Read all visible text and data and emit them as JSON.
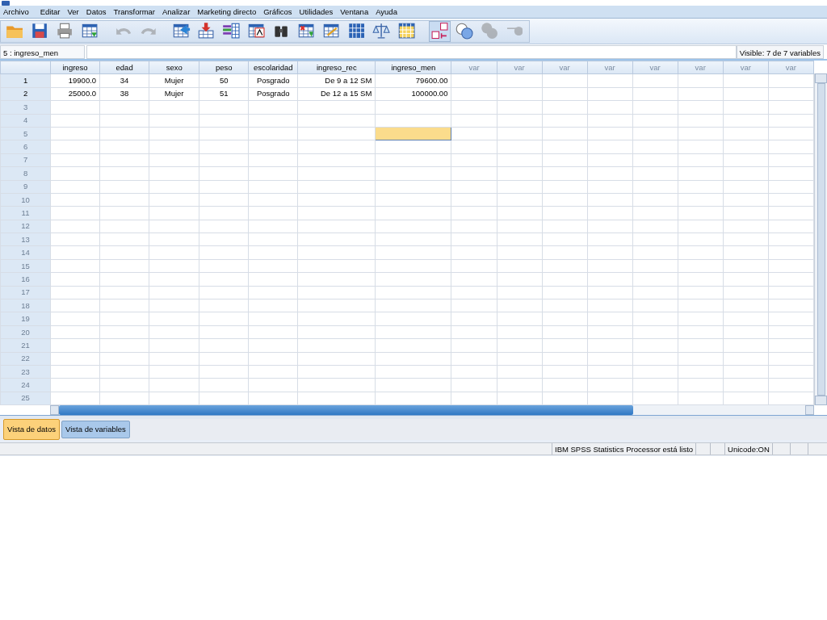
{
  "menu": [
    {
      "label": "Archivo"
    },
    {
      "label": "Editar"
    },
    {
      "label": "Ver"
    },
    {
      "label": "Datos"
    },
    {
      "label": "Transformar"
    },
    {
      "label": "Analizar"
    },
    {
      "label": "Marketing directo"
    },
    {
      "label": "Gráficos"
    },
    {
      "label": "Utilidades"
    },
    {
      "label": "Ventana"
    },
    {
      "label": "Ayuda"
    }
  ],
  "toolbar": [
    {
      "kind": "folder"
    },
    {
      "kind": "save"
    },
    {
      "kind": "print"
    },
    {
      "kind": "recall"
    },
    {
      "kind": "sep"
    },
    {
      "kind": "undo",
      "disabled": true
    },
    {
      "kind": "redo",
      "disabled": true
    },
    {
      "kind": "sep"
    },
    {
      "kind": "gotocase"
    },
    {
      "kind": "gotovar"
    },
    {
      "kind": "variables"
    },
    {
      "kind": "stats"
    },
    {
      "kind": "find"
    },
    {
      "kind": "insertcase"
    },
    {
      "kind": "insertvar"
    },
    {
      "kind": "split"
    },
    {
      "kind": "weight"
    },
    {
      "kind": "select"
    },
    {
      "kind": "sep"
    },
    {
      "kind": "labels",
      "selected": true
    },
    {
      "kind": "sets"
    },
    {
      "kind": "showall",
      "disabled": true
    },
    {
      "kind": "spell",
      "disabled": true
    }
  ],
  "cell_editor": {
    "reference": "5 : ingreso_men",
    "visible": "Visible: 7 de 7 variables"
  },
  "table": {
    "columns": [
      {
        "label": "ingreso",
        "kind": "data"
      },
      {
        "label": "edad",
        "kind": "data"
      },
      {
        "label": "sexo",
        "kind": "data"
      },
      {
        "label": "peso",
        "kind": "data"
      },
      {
        "label": "escolaridad",
        "kind": "data"
      },
      {
        "label": "ingreso_rec",
        "kind": "data"
      },
      {
        "label": "ingreso_men",
        "kind": "data"
      },
      {
        "label": "var",
        "kind": "empty"
      },
      {
        "label": "var",
        "kind": "empty"
      },
      {
        "label": "var",
        "kind": "empty"
      },
      {
        "label": "var",
        "kind": "empty"
      },
      {
        "label": "var",
        "kind": "empty"
      },
      {
        "label": "var",
        "kind": "empty"
      },
      {
        "label": "var",
        "kind": "empty"
      },
      {
        "label": "var",
        "kind": "empty"
      }
    ],
    "rows": [
      {
        "number": "1",
        "cells": [
          {
            "text": "19900.0",
            "selected": false
          },
          {
            "text": "34",
            "selected": false
          },
          {
            "text": "Mujer",
            "selected": false
          },
          {
            "text": "50",
            "selected": false
          },
          {
            "text": "Posgrado",
            "selected": false
          },
          {
            "text": "De 9 a 12 SM",
            "selected": false
          },
          {
            "text": "79600.00",
            "selected": false
          }
        ]
      },
      {
        "number": "2",
        "cells": [
          {
            "text": "25000.0",
            "selected": false
          },
          {
            "text": "38",
            "selected": false
          },
          {
            "text": "Mujer",
            "selected": false
          },
          {
            "text": "51",
            "selected": false
          },
          {
            "text": "Posgrado",
            "selected": false
          },
          {
            "text": "De 12 a 15 SM",
            "selected": false
          },
          {
            "text": "100000.00",
            "selected": false
          }
        ]
      },
      {
        "number": "3",
        "cells": [
          {
            "selected": false
          },
          {
            "selected": false
          },
          {
            "selected": false
          },
          {
            "selected": false
          },
          {
            "selected": false
          },
          {
            "selected": false
          },
          {
            "selected": false
          }
        ]
      },
      {
        "number": "4",
        "cells": [
          {
            "selected": false
          },
          {
            "selected": false
          },
          {
            "selected": false
          },
          {
            "selected": false
          },
          {
            "selected": false
          },
          {
            "selected": false
          },
          {
            "selected": false
          }
        ]
      },
      {
        "number": "5",
        "cells": [
          {
            "selected": false
          },
          {
            "selected": false
          },
          {
            "selected": false
          },
          {
            "selected": false
          },
          {
            "selected": false
          },
          {
            "selected": false
          },
          {
            "selected": true
          }
        ]
      },
      {
        "number": "6",
        "cells": [
          {
            "selected": false
          },
          {
            "selected": false
          },
          {
            "selected": false
          },
          {
            "selected": false
          },
          {
            "selected": false
          },
          {
            "selected": false
          },
          {
            "selected": false
          }
        ]
      },
      {
        "number": "7",
        "cells": [
          {
            "selected": false
          },
          {
            "selected": false
          },
          {
            "selected": false
          },
          {
            "selected": false
          },
          {
            "selected": false
          },
          {
            "selected": false
          },
          {
            "selected": false
          }
        ]
      },
      {
        "number": "8",
        "cells": [
          {
            "selected": false
          },
          {
            "selected": false
          },
          {
            "selected": false
          },
          {
            "selected": false
          },
          {
            "selected": false
          },
          {
            "selected": false
          },
          {
            "selected": false
          }
        ]
      },
      {
        "number": "9",
        "cells": [
          {
            "selected": false
          },
          {
            "selected": false
          },
          {
            "selected": false
          },
          {
            "selected": false
          },
          {
            "selected": false
          },
          {
            "selected": false
          },
          {
            "selected": false
          }
        ]
      },
      {
        "number": "10",
        "cells": [
          {
            "selected": false
          },
          {
            "selected": false
          },
          {
            "selected": false
          },
          {
            "selected": false
          },
          {
            "selected": false
          },
          {
            "selected": false
          },
          {
            "selected": false
          }
        ]
      },
      {
        "number": "11",
        "cells": [
          {
            "selected": false
          },
          {
            "selected": false
          },
          {
            "selected": false
          },
          {
            "selected": false
          },
          {
            "selected": false
          },
          {
            "selected": false
          },
          {
            "selected": false
          }
        ]
      },
      {
        "number": "12",
        "cells": [
          {
            "selected": false
          },
          {
            "selected": false
          },
          {
            "selected": false
          },
          {
            "selected": false
          },
          {
            "selected": false
          },
          {
            "selected": false
          },
          {
            "selected": false
          }
        ]
      },
      {
        "number": "13",
        "cells": [
          {
            "selected": false
          },
          {
            "selected": false
          },
          {
            "selected": false
          },
          {
            "selected": false
          },
          {
            "selected": false
          },
          {
            "selected": false
          },
          {
            "selected": false
          }
        ]
      },
      {
        "number": "14",
        "cells": [
          {
            "selected": false
          },
          {
            "selected": false
          },
          {
            "selected": false
          },
          {
            "selected": false
          },
          {
            "selected": false
          },
          {
            "selected": false
          },
          {
            "selected": false
          }
        ]
      },
      {
        "number": "15",
        "cells": [
          {
            "selected": false
          },
          {
            "selected": false
          },
          {
            "selected": false
          },
          {
            "selected": false
          },
          {
            "selected": false
          },
          {
            "selected": false
          },
          {
            "selected": false
          }
        ]
      },
      {
        "number": "16",
        "cells": [
          {
            "selected": false
          },
          {
            "selected": false
          },
          {
            "selected": false
          },
          {
            "selected": false
          },
          {
            "selected": false
          },
          {
            "selected": false
          },
          {
            "selected": false
          }
        ]
      },
      {
        "number": "17",
        "cells": [
          {
            "selected": false
          },
          {
            "selected": false
          },
          {
            "selected": false
          },
          {
            "selected": false
          },
          {
            "selected": false
          },
          {
            "selected": false
          },
          {
            "selected": false
          }
        ]
      },
      {
        "number": "18",
        "cells": [
          {
            "selected": false
          },
          {
            "selected": false
          },
          {
            "selected": false
          },
          {
            "selected": false
          },
          {
            "selected": false
          },
          {
            "selected": false
          },
          {
            "selected": false
          }
        ]
      },
      {
        "number": "19",
        "cells": [
          {
            "selected": false
          },
          {
            "selected": false
          },
          {
            "selected": false
          },
          {
            "selected": false
          },
          {
            "selected": false
          },
          {
            "selected": false
          },
          {
            "selected": false
          }
        ]
      },
      {
        "number": "20",
        "cells": [
          {
            "selected": false
          },
          {
            "selected": false
          },
          {
            "selected": false
          },
          {
            "selected": false
          },
          {
            "selected": false
          },
          {
            "selected": false
          },
          {
            "selected": false
          }
        ]
      },
      {
        "number": "21",
        "cells": [
          {
            "selected": false
          },
          {
            "selected": false
          },
          {
            "selected": false
          },
          {
            "selected": false
          },
          {
            "selected": false
          },
          {
            "selected": false
          },
          {
            "selected": false
          }
        ]
      },
      {
        "number": "22",
        "cells": [
          {
            "selected": false
          },
          {
            "selected": false
          },
          {
            "selected": false
          },
          {
            "selected": false
          },
          {
            "selected": false
          },
          {
            "selected": false
          },
          {
            "selected": false
          }
        ]
      },
      {
        "number": "23",
        "cells": [
          {
            "selected": false
          },
          {
            "selected": false
          },
          {
            "selected": false
          },
          {
            "selected": false
          },
          {
            "selected": false
          },
          {
            "selected": false
          },
          {
            "selected": false
          }
        ]
      },
      {
        "number": "24",
        "cells": [
          {
            "selected": false
          },
          {
            "selected": false
          },
          {
            "selected": false
          },
          {
            "selected": false
          },
          {
            "selected": false
          },
          {
            "selected": false
          },
          {
            "selected": false
          }
        ]
      },
      {
        "number": "25",
        "cells": [
          {
            "selected": false
          },
          {
            "selected": false
          },
          {
            "selected": false
          },
          {
            "selected": false
          },
          {
            "selected": false
          },
          {
            "selected": false
          },
          {
            "selected": false
          }
        ]
      }
    ]
  },
  "tabs": [
    {
      "label": "Vista de datos",
      "selected": true
    },
    {
      "label": "Vista de variables",
      "selected": false
    }
  ],
  "status_bar": {
    "message": "IBM SPSS Statistics Processor está listo",
    "encoding": "Unicode:ON"
  }
}
